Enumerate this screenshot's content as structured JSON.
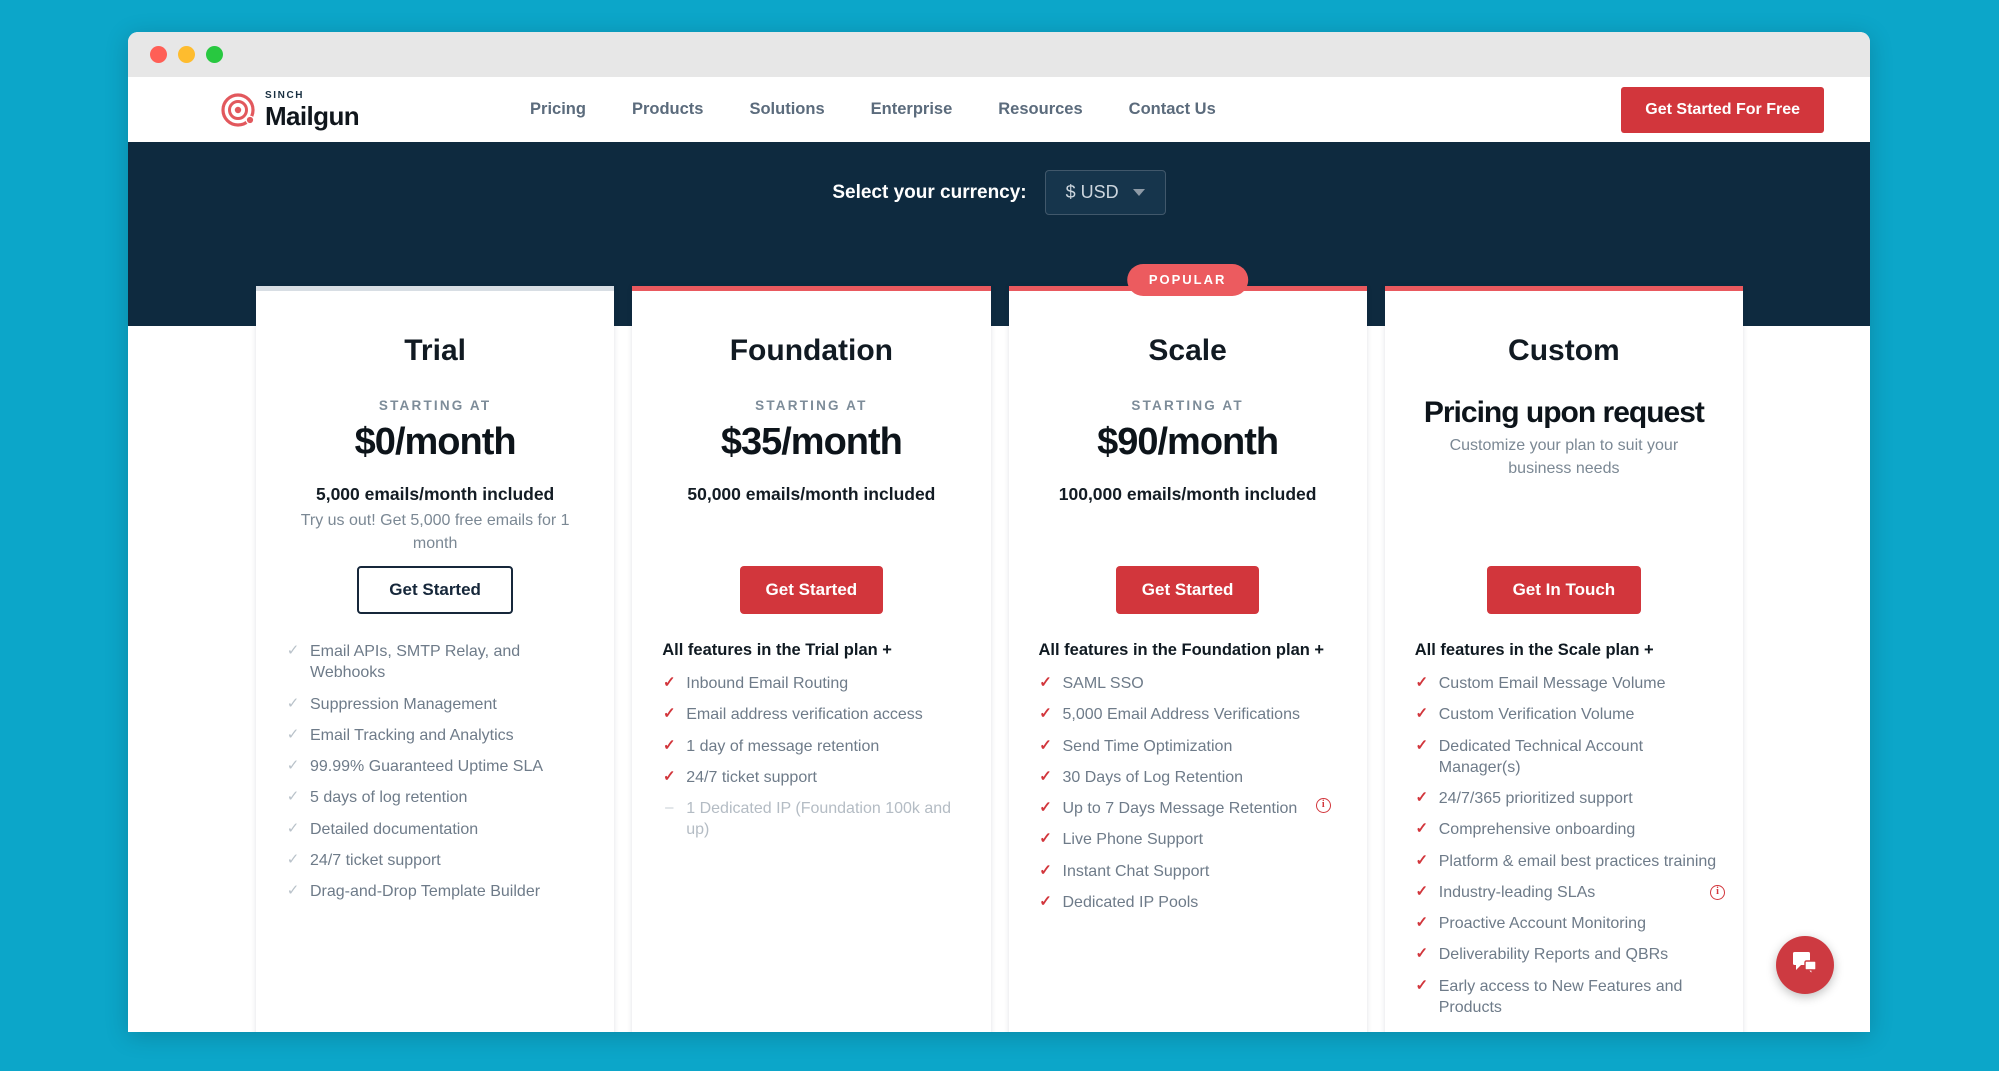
{
  "window": {
    "traffic_lights": [
      "close",
      "minimize",
      "maximize"
    ]
  },
  "brand": {
    "sinch": "SINCH",
    "name": "Mailgun",
    "accent_red": "#d2363c",
    "accent_coral": "#ec5b5f",
    "dark_navy": "#0e2a3f",
    "page_background": "#0CA6C9"
  },
  "nav": {
    "links": [
      {
        "label": "Pricing"
      },
      {
        "label": "Products"
      },
      {
        "label": "Solutions"
      },
      {
        "label": "Enterprise"
      },
      {
        "label": "Resources"
      },
      {
        "label": "Contact Us"
      }
    ],
    "cta": "Get Started For Free"
  },
  "currency": {
    "label": "Select your currency:",
    "selected": "$ USD"
  },
  "popular_badge": "POPULAR",
  "plans": [
    {
      "name": "Trial",
      "accent": "gray",
      "popular": false,
      "starting_at": "STARTING AT",
      "price": "$0/month",
      "emails": "5,000 emails/month included",
      "subnote": "Try us out! Get 5,000 free emails for 1 month",
      "button": "Get Started",
      "button_style": "outline",
      "features_title": "",
      "features": [
        {
          "mark": "check-gray",
          "label": "Email APIs, SMTP Relay, and Webhooks"
        },
        {
          "mark": "check-gray",
          "label": "Suppression Management"
        },
        {
          "mark": "check-gray",
          "label": "Email Tracking and Analytics"
        },
        {
          "mark": "check-gray",
          "label": "99.99% Guaranteed Uptime SLA"
        },
        {
          "mark": "check-gray",
          "label": "5 days of log retention"
        },
        {
          "mark": "check-gray",
          "label": "Detailed documentation"
        },
        {
          "mark": "check-gray",
          "label": "24/7 ticket support"
        },
        {
          "mark": "check-gray",
          "label": "Drag-and-Drop Template Builder"
        }
      ]
    },
    {
      "name": "Foundation",
      "accent": "red",
      "popular": false,
      "starting_at": "STARTING AT",
      "price": "$35/month",
      "emails": "50,000 emails/month included",
      "subnote": "",
      "button": "Get Started",
      "button_style": "solid",
      "features_title": "All features in the Trial plan +",
      "features": [
        {
          "mark": "check-red",
          "label": "Inbound Email Routing"
        },
        {
          "mark": "check-red",
          "label": "Email address verification access"
        },
        {
          "mark": "check-red",
          "label": "1 day of message retention"
        },
        {
          "mark": "check-red",
          "label": "24/7 ticket support"
        },
        {
          "mark": "dash",
          "label": "1 Dedicated IP (Foundation 100k and up)",
          "muted": true
        }
      ]
    },
    {
      "name": "Scale",
      "accent": "red",
      "popular": true,
      "starting_at": "STARTING AT",
      "price": "$90/month",
      "emails": "100,000 emails/month included",
      "subnote": "",
      "button": "Get Started",
      "button_style": "solid",
      "features_title": "All features in the Foundation plan +",
      "features": [
        {
          "mark": "check-red",
          "label": "SAML SSO"
        },
        {
          "mark": "check-red",
          "label": "5,000 Email Address Verifications"
        },
        {
          "mark": "check-red",
          "label": "Send Time Optimization"
        },
        {
          "mark": "check-red",
          "label": "30 Days of Log Retention"
        },
        {
          "mark": "check-red",
          "label": "Up to 7 Days Message Retention",
          "info": true,
          "info_far": true
        },
        {
          "mark": "check-red",
          "label": "Live Phone Support"
        },
        {
          "mark": "check-red",
          "label": "Instant Chat Support"
        },
        {
          "mark": "check-red",
          "label": "Dedicated IP Pools"
        }
      ]
    },
    {
      "name": "Custom",
      "accent": "red",
      "popular": false,
      "starting_at": "",
      "price": "Pricing upon request",
      "price_is_request": true,
      "emails": "",
      "subnote": "Customize your plan to suit your business needs",
      "button": "Get In Touch",
      "button_style": "solid",
      "features_title": "All features in the Scale plan +",
      "features": [
        {
          "mark": "check-red",
          "label": "Custom Email Message Volume"
        },
        {
          "mark": "check-red",
          "label": "Custom Verification Volume"
        },
        {
          "mark": "check-red",
          "label": "Dedicated Technical Account Manager(s)"
        },
        {
          "mark": "check-red",
          "label": "24/7/365 prioritized support"
        },
        {
          "mark": "check-red",
          "label": "Comprehensive onboarding"
        },
        {
          "mark": "check-red",
          "label": "Platform & email best practices training"
        },
        {
          "mark": "check-red",
          "label": "Industry-leading SLAs",
          "info": true
        },
        {
          "mark": "check-red",
          "label": "Proactive Account Monitoring"
        },
        {
          "mark": "check-red",
          "label": "Deliverability Reports and QBRs"
        },
        {
          "mark": "check-red",
          "label": "Early access to New Features and Products"
        }
      ]
    }
  ],
  "chat_widget": {
    "icon": "chat-bubbles-icon"
  }
}
